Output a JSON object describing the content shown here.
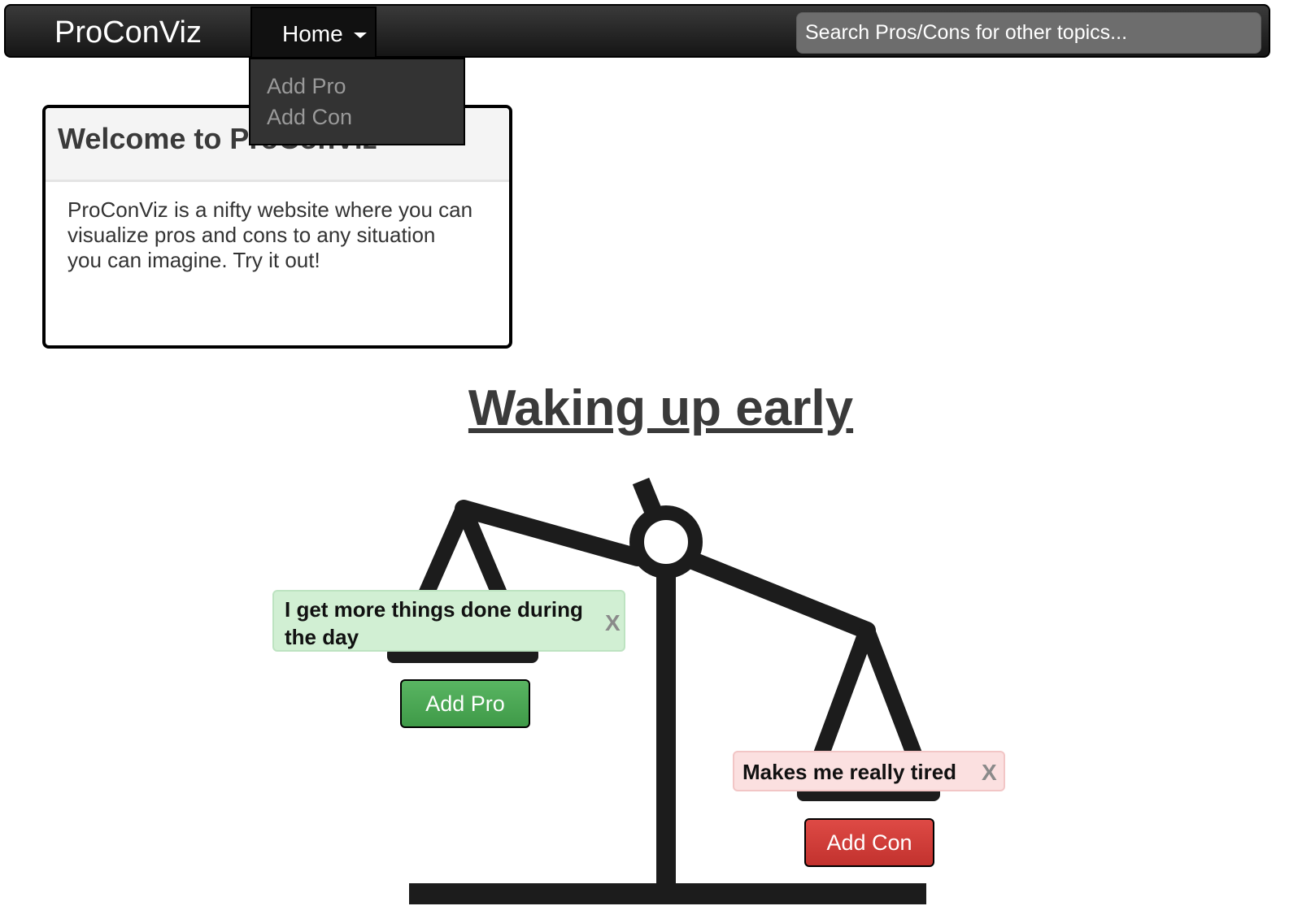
{
  "navbar": {
    "brand": "ProConViz",
    "home_label": "Home",
    "search_placeholder": "Search Pros/Cons for other topics..."
  },
  "dropdown": {
    "items": [
      "Add Pro",
      "Add Con"
    ]
  },
  "welcome": {
    "title": "Welcome to ProConViz",
    "body": "ProConViz is a nifty website where you can visualize pros and cons to any situation you can imagine.  Try it out!"
  },
  "topic": {
    "title": "Waking up early"
  },
  "pros": [
    {
      "text": "I get more things done during the day",
      "remove": "X"
    }
  ],
  "cons": [
    {
      "text": "Makes me really tired",
      "remove": "X"
    }
  ],
  "buttons": {
    "add_pro": "Add Pro",
    "add_con": "Add Con"
  },
  "colors": {
    "pro_bg": "#d1efd3",
    "con_bg": "#fbe0e0",
    "pro_button": "#4cae54",
    "con_button": "#d03c37",
    "navbar": "#222222"
  },
  "icons": {
    "scale": "balance-scale-icon",
    "caret": "caret-down-icon",
    "remove": "close-icon"
  }
}
